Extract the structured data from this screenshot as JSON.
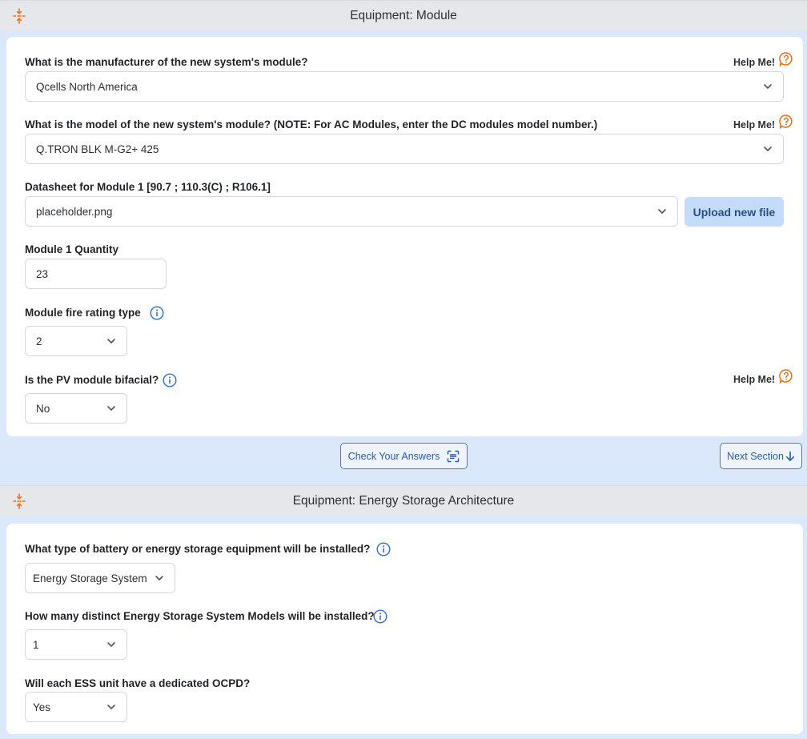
{
  "section1": {
    "title": "Equipment: Module",
    "help_label": "Help Me!",
    "q_manufacturer": "What is the manufacturer of the new system's module?",
    "manufacturer_value": "Qcells North America",
    "q_model": "What is the model of the new system's module? (NOTE: For AC Modules, enter the DC modules model number.)",
    "model_value": "Q.TRON BLK M-G2+ 425",
    "datasheet_label": "Datasheet for Module 1 [90.7 ; 110.3(C) ; R106.1]",
    "datasheet_value": "placeholder.png",
    "upload_label": "Upload new file",
    "quantity_label": "Module 1 Quantity",
    "quantity_value": "23",
    "fire_rating_label": "Module fire rating type",
    "fire_rating_value": "2",
    "bifacial_label": "Is the PV module bifacial?",
    "bifacial_value": "No",
    "check_answers_label": "Check Your Answers",
    "next_section_label": "Next Section"
  },
  "section2": {
    "title": "Equipment: Energy Storage Architecture",
    "q_battery_type": "What type of battery or energy storage equipment will be installed?",
    "battery_type_value": "Energy Storage System",
    "q_models_count": "How many distinct Energy Storage System Models will be installed?",
    "models_count_value": "1",
    "q_ocpd": "Will each ESS unit have a dedicated OCPD?",
    "ocpd_value": "Yes"
  },
  "colors": {
    "accent_orange": "#e8711c",
    "info_blue": "#2f6fd6",
    "upload_bg": "#c4dbf9",
    "page_bg": "#dbe8fb"
  },
  "icons": {
    "collapse": "collapse-arrows-icon",
    "help": "help-speech-bubble-icon",
    "info": "info-circle-icon",
    "chevron": "chevron-down-icon",
    "scan": "scan-check-icon",
    "arrow": "arrow-down-icon"
  }
}
